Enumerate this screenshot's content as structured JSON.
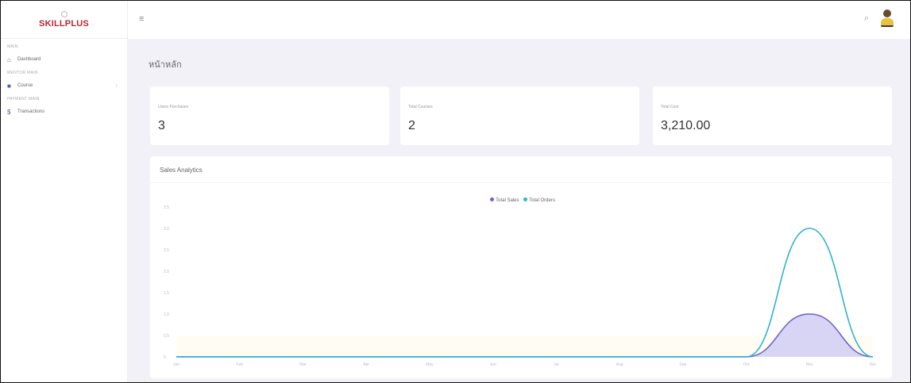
{
  "sidebar": {
    "logo": "SKILLPLUS",
    "sections": [
      "MAIN",
      "MENTOR MAIN",
      "PAYMENT MAIN"
    ],
    "items": [
      {
        "label": "Dashboard",
        "icon": "home-icon"
      },
      {
        "label": "Course",
        "icon": "book-icon"
      },
      {
        "label": "Transactions",
        "icon": "dollar-icon"
      }
    ]
  },
  "header": {
    "page_title": "หน้าหลัก"
  },
  "stats": [
    {
      "label": "Users Purchases",
      "value": "3"
    },
    {
      "label": "Total Courses",
      "value": "2"
    },
    {
      "label": "Total Cost",
      "value": "3,210.00"
    }
  ],
  "analytics": {
    "title": "Sales Analytics"
  },
  "colors": {
    "accent": "#4a5fb3",
    "brand": "#b8262f",
    "sales": "#6f63c9",
    "orders": "#31b3cf"
  },
  "chart_data": {
    "type": "area",
    "legend_position": "top-center",
    "grid": false,
    "x": [
      "Jan",
      "Feb",
      "Mar",
      "Apr",
      "May",
      "Jun",
      "Jul",
      "Aug",
      "Sep",
      "Oct",
      "Nov",
      "Dec"
    ],
    "ylim": [
      0,
      3.5
    ],
    "y_ticks": [
      "0",
      "0.5",
      "1.0",
      "1.5",
      "2.0",
      "2.5",
      "3.0",
      "3.5"
    ],
    "series": [
      {
        "name": "Total Sales",
        "values": [
          0,
          0,
          0,
          0,
          0,
          0,
          0,
          0,
          0,
          0,
          1,
          0
        ]
      },
      {
        "name": "Total Orders",
        "values": [
          0,
          0,
          0,
          0,
          0,
          0,
          0,
          0,
          0,
          0,
          3,
          0
        ]
      }
    ]
  }
}
